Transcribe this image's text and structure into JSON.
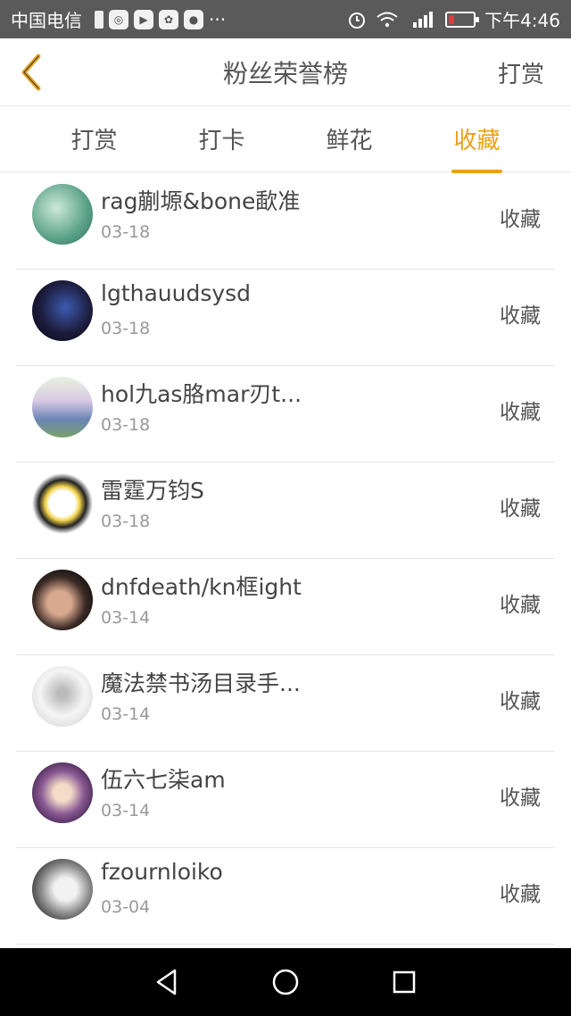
{
  "status_bar": {
    "carrier": "中国电信",
    "time": "下午4:46"
  },
  "header": {
    "title": "粉丝荣誉榜",
    "action_label": "打赏"
  },
  "tabs": [
    {
      "label": "打赏",
      "active": false
    },
    {
      "label": "打卡",
      "active": false
    },
    {
      "label": "鲜花",
      "active": false
    },
    {
      "label": "收藏",
      "active": true
    }
  ],
  "list": [
    {
      "name": "rag蒯塬&bone歃准",
      "date": "03-18",
      "action": "收藏"
    },
    {
      "name": "lgthauudsysd",
      "date": "03-18",
      "action": "收藏"
    },
    {
      "name": "hol九as胳mar刃t...",
      "date": "03-18",
      "action": "收藏"
    },
    {
      "name": "雷霆万钧S",
      "date": "03-18",
      "action": "收藏"
    },
    {
      "name": "dnfdeath/kn框ight",
      "date": "03-14",
      "action": "收藏"
    },
    {
      "name": "魔法禁书汤目录手...",
      "date": "03-14",
      "action": "收藏"
    },
    {
      "name": "伍六七柒am",
      "date": "03-14",
      "action": "收藏"
    },
    {
      "name": "fzournloiko",
      "date": "03-04",
      "action": "收藏"
    }
  ],
  "colors": {
    "accent": "#e9a11a",
    "status_bar_bg": "#5a5a5a",
    "nav_bar_bg": "#000000"
  }
}
